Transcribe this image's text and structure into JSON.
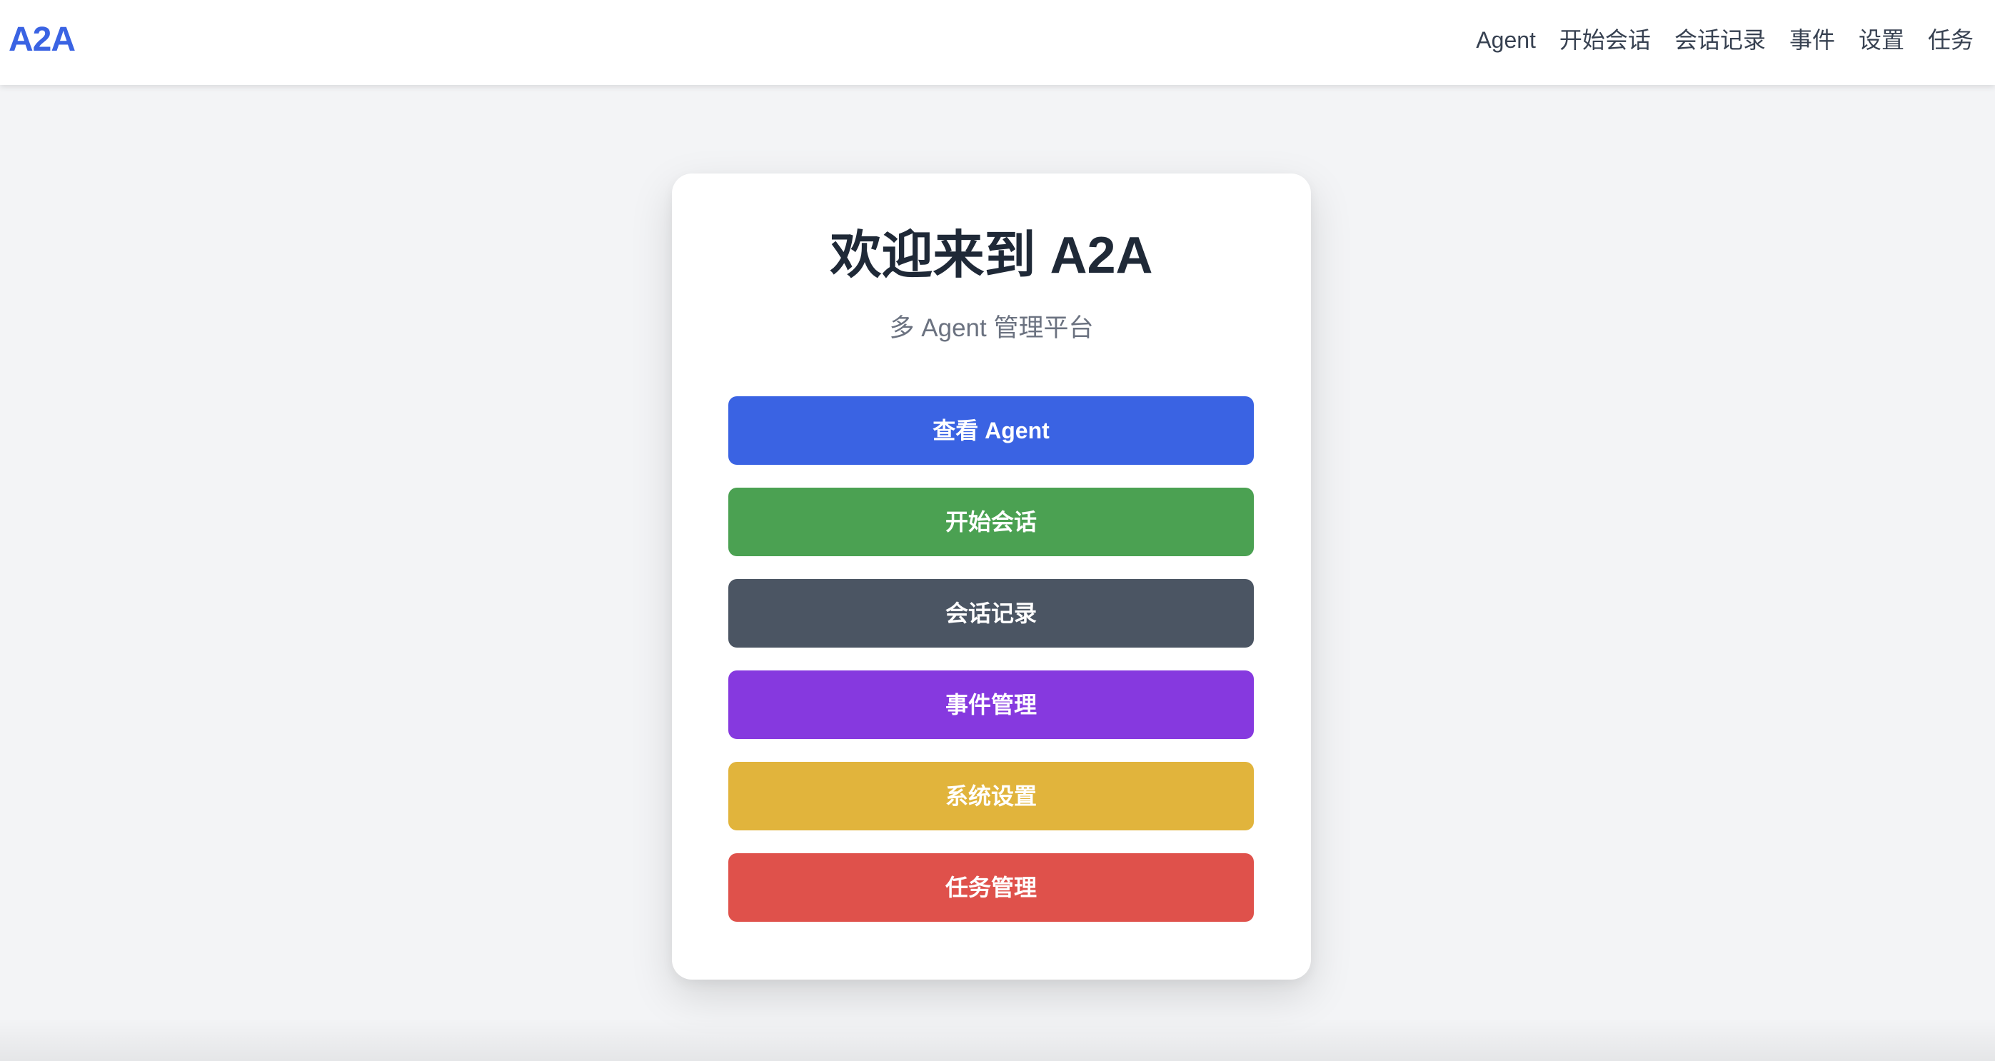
{
  "header": {
    "logo": "A2A",
    "nav": [
      {
        "label": "Agent"
      },
      {
        "label": "开始会话"
      },
      {
        "label": "会话记录"
      },
      {
        "label": "事件"
      },
      {
        "label": "设置"
      },
      {
        "label": "任务"
      }
    ]
  },
  "card": {
    "title": "欢迎来到 A2A",
    "subtitle": "多 Agent 管理平台",
    "buttons": [
      {
        "label": "查看 Agent",
        "color": "#3a63e3"
      },
      {
        "label": "开始会话",
        "color": "#4ba152"
      },
      {
        "label": "会话记录",
        "color": "#4b5563"
      },
      {
        "label": "事件管理",
        "color": "#8639df"
      },
      {
        "label": "系统设置",
        "color": "#e1b43c"
      },
      {
        "label": "任务管理",
        "color": "#df514b"
      }
    ]
  },
  "colors": {
    "brand": "#3a63e3",
    "background": "#f3f4f6",
    "card": "#ffffff",
    "title_text": "#1f2937",
    "subtitle_text": "#6b7280",
    "nav_text": "#374151"
  }
}
